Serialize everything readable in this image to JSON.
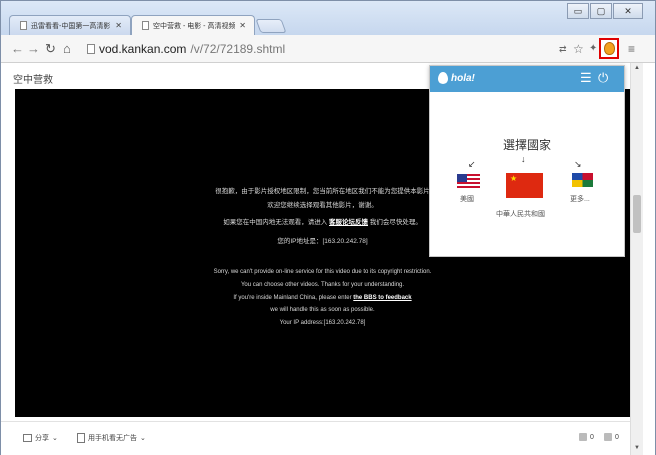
{
  "browser": {
    "tabs": [
      {
        "title": "迅雷看看-中国第一高清影",
        "active": false
      },
      {
        "title": "空中营救 - 电影 - 高清视频",
        "active": true
      }
    ],
    "window_controls": [
      "▭",
      "▢",
      "✕"
    ],
    "url_host": "vod.kankan.com",
    "url_path": "/v/72/72189.shtml",
    "accent_color": "#4c9fd4",
    "highlight_color": "#e00000"
  },
  "page": {
    "title": "空中营救",
    "video_message_cn": [
      "很抱歉，由于影片授权地区限制，您当前所在地区我们不能为您提供本影片",
      "欢迎您继续选择观看其他影片，谢谢。",
      "如果您在中国内地无法观看，请进入",
      "客服论坛反馈",
      "我们会尽快处理。",
      "您的IP地址是：[163.20.242.78]"
    ],
    "video_message_en": [
      "Sorry, we can't provide on-line service for this video due to its copyright restriction.",
      "You can choose other videos. Thanks for your understanding.",
      "If you're inside Mainland China, please enter",
      "the BBS to feedback",
      "we will handle this as soon as possible.",
      "Your IP address:[163.20.242.78]"
    ],
    "bottom_bar": {
      "share_label": "分享",
      "mobile_label": "用手机看无广告",
      "dropdown_caret": "⌄",
      "like_count": "0",
      "dislike_count": "0"
    }
  },
  "hola": {
    "logo_text": "hola!",
    "choose_title": "選擇國家",
    "countries": [
      {
        "label": "美國",
        "flag": "us-flag"
      },
      {
        "label": "中華人民共和國",
        "flag": "cn-flag"
      },
      {
        "label": "更多...",
        "flag": "more-flags"
      }
    ]
  }
}
